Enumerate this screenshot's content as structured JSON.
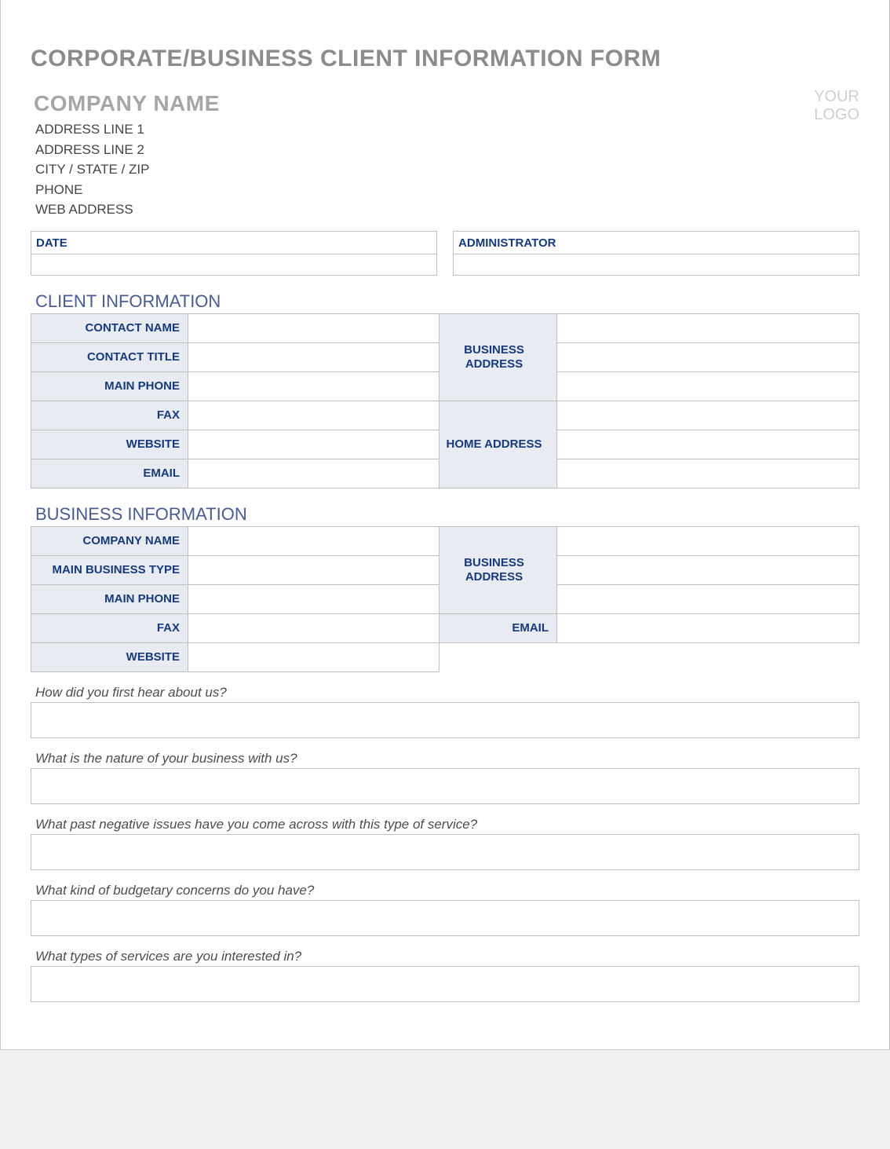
{
  "formTitle": "CORPORATE/BUSINESS CLIENT INFORMATION FORM",
  "companyHeading": "COMPANY NAME",
  "logoPlaceholder": {
    "l1": "YOUR",
    "l2": "LOGO"
  },
  "address": {
    "l1": "ADDRESS LINE 1",
    "l2": "ADDRESS LINE 2",
    "l3": "CITY / STATE / ZIP",
    "l4": "PHONE",
    "l5": "WEB ADDRESS"
  },
  "topFields": {
    "date": "DATE",
    "administrator": "ADMINISTRATOR"
  },
  "sections": {
    "client": "CLIENT INFORMATION",
    "business": "BUSINESS INFORMATION"
  },
  "clientLabels": {
    "contactName": "CONTACT NAME",
    "contactTitle": "CONTACT TITLE",
    "mainPhone": "MAIN PHONE",
    "fax": "FAX",
    "website": "WEBSITE",
    "email": "EMAIL",
    "businessAddress": "BUSINESS ADDRESS",
    "homeAddress": "HOME ADDRESS"
  },
  "businessLabels": {
    "companyName": "COMPANY NAME",
    "mainBusinessType": "MAIN BUSINESS TYPE",
    "mainPhone": "MAIN PHONE",
    "fax": "FAX",
    "website": "WEBSITE",
    "businessAddress": "BUSINESS ADDRESS",
    "email": "EMAIL"
  },
  "questions": {
    "q1": "How did you first hear about us?",
    "q2": "What is the nature of your business with us?",
    "q3": "What past negative issues have you come across with this type of service?",
    "q4": "What kind of budgetary concerns do you have?",
    "q5": "What types of services are you interested in?"
  }
}
